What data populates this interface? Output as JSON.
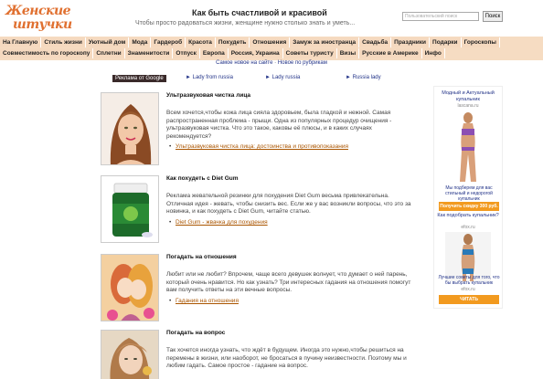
{
  "header": {
    "logo_line1": "Женские",
    "logo_line2": "штучки",
    "title": "Как быть счастливой и красивой",
    "subtitle": "Чтобы просто радоваться жизни, женщине нужно столько знать и уметь...",
    "search_placeholder": "Пользовательский поиск",
    "search_button": "Поиск"
  },
  "nav": {
    "row1": [
      "На Главную",
      "Стиль жизни",
      "Уютный дом",
      "Мода",
      "Гардероб",
      "Красота",
      "Похудеть",
      "Отношения",
      "Замуж за иностранца",
      "Свадьба",
      "Праздники",
      "Подарки",
      "Гороскопы"
    ],
    "row2": [
      "Совместимость по гороскопу",
      "Сплетни",
      "Знаменитости",
      "Отпуск",
      "Европа",
      "Россия, Украина",
      "Советы туристу",
      "Визы",
      "Русские в Америке",
      "Инфо"
    ]
  },
  "news_line": {
    "left": "Самое новое на сайте",
    "sep": " · ",
    "right": "Новое по рубрикам"
  },
  "ads_bar": {
    "google": "Реклама от Google",
    "links": [
      "► Lady from russia",
      "► Lady russia",
      "► Russia lady"
    ]
  },
  "articles": [
    {
      "title": "Ультразвуковая чистка лица",
      "text": "Всем хочется,чтобы кожа лица сияла здоровьем, была гладкой и нежной. Самая распространенная проблема - прыщи. Одна из популярных процедур очищения - ультразвуковая чистка. Что это такое, каковы её плюсы, и в каких случаях рекомендуется?",
      "link": "Ультразвуковая чистка лица: достоинства и противопоказания"
    },
    {
      "title": "Как похудеть с Diet Gum",
      "text": "Реклама жевательной резинки для похудения Diet Gum весьма привлекательна. Отличная идея - жевать, чтобы снизить вес. Если же у вас возникли вопросы, что это за новинка, и как похудеть с Diet Gum, читайте статью.",
      "link": "Diet Gum - жвачка для похудения"
    },
    {
      "title": "Погадать на отношения",
      "text": "Любит или не любит? Впрочем, чаще всего девушек волнует, что думает о ней парень, который очень нравится. Но как узнать? Три интересных гадания на отношения помогут вам получить ответы на эти вечные вопросы.",
      "link": "Гадания на отношения"
    },
    {
      "title": "Погадать на вопрос",
      "text": "Так хочется иногда узнать, что ждёт в будущем. Иногда это нужно,чтобы решиться на перемены в жизни, или наоборот, не бросаться в пучину неизвестности. Поэтому мы и любим гадать. Самое простое - гадание на вопрос.",
      "link": ""
    }
  ],
  "sidebar_ad": {
    "head1": "Модный и Актуальный купальник",
    "site1": "lascana.ru",
    "cap1": "Мы подберем для вас стильный и недорогой купальник",
    "btn1": "Получить скидку 300 руб.",
    "head2": "Как подобрать купальник?",
    "site2": "efox.ru",
    "cap2": "Лучшие советы для того, что бы выбрать купальник",
    "btn2": "ЧИТАТЬ"
  },
  "colors": {
    "logo": "#e07030",
    "nav_bg": "#f5d9bf",
    "link": "#aa5500",
    "accent_button": "#f29a1f"
  }
}
